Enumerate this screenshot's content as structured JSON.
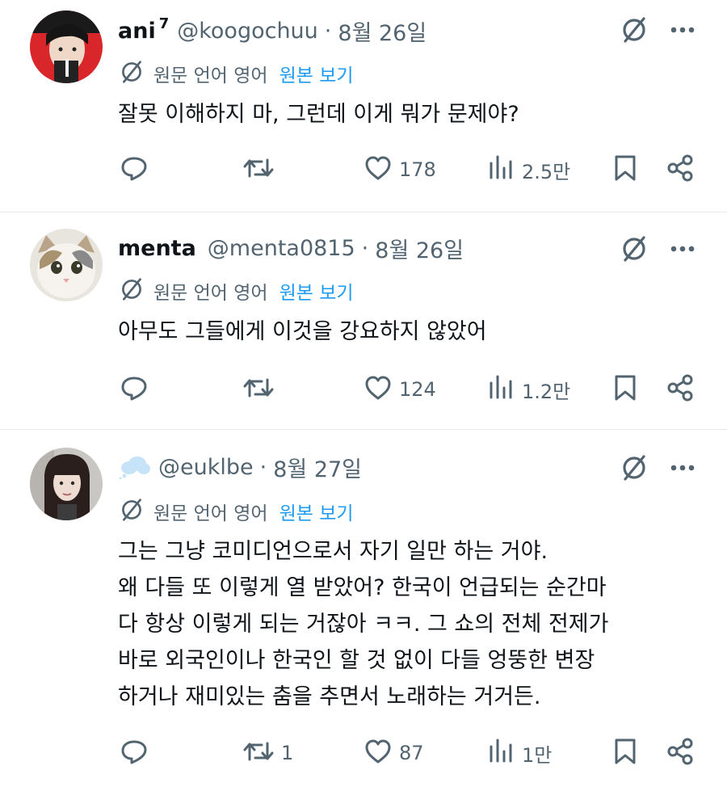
{
  "translate_label": "원문 언어 영어",
  "view_original_label": "원본 보기",
  "icons": {
    "mute": "no-symbol-icon",
    "more": "more-dots-icon",
    "translate": "translate-icon",
    "reply": "reply-icon",
    "retweet": "retweet-icon",
    "like": "heart-icon",
    "views": "views-bar-icon",
    "bookmark": "bookmark-icon",
    "share": "share-icon"
  },
  "colors": {
    "text": "#0f1419",
    "muted": "#536471",
    "link": "#1d9bf0",
    "divider": "#e7e9ea"
  },
  "tweets": [
    {
      "display_name": "ani",
      "badge": "7",
      "handle": "@koogochuu",
      "separator": "·",
      "date": "8월 26일",
      "text": "잘못 이해하지 마, 그런데 이게 뭐가 문제야?",
      "retweets": "",
      "likes": "178",
      "views": "2.5만"
    },
    {
      "display_name": "menta",
      "badge": "",
      "handle": "@menta0815",
      "separator": "·",
      "date": "8월 26일",
      "text": "아무도 그들에게 이것을 강요하지 않았어",
      "retweets": "",
      "likes": "124",
      "views": "1.2만"
    },
    {
      "display_name": "",
      "badge": "",
      "handle": "@euklbe",
      "separator": "·",
      "date": "8월 27일",
      "text": "그는 그냥 코미디언으로서 자기 일만 하는 거야.\n왜 다들 또 이렇게 열 받았어? 한국이 언급되는 순간마\n다 항상 이렇게 되는 거잖아 ㅋㅋ. 그 쇼의 전체 전제가\n바로 외국인이나 한국인 할 것 없이 다들 엉뚱한 변장\n하거나 재미있는 춤을 추면서 노래하는 거거든.",
      "retweets": "1",
      "likes": "87",
      "views": "1만"
    }
  ]
}
